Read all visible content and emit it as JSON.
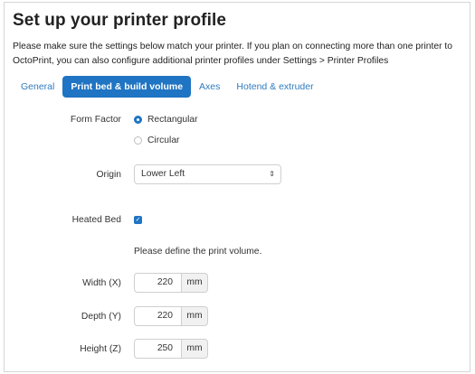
{
  "title": "Set up your printer profile",
  "description": "Please make sure the settings below match your printer. If you plan on connecting more than one printer to OctoPrint, you can also configure additional printer profiles under Settings > Printer Profiles",
  "tabs": [
    {
      "label": "General"
    },
    {
      "label": "Print bed & build volume"
    },
    {
      "label": "Axes"
    },
    {
      "label": "Hotend & extruder"
    }
  ],
  "form_factor": {
    "label": "Form Factor",
    "options": [
      {
        "label": "Rectangular",
        "checked": true
      },
      {
        "label": "Circular",
        "checked": false
      }
    ]
  },
  "origin": {
    "label": "Origin",
    "value": "Lower Left"
  },
  "heated_bed": {
    "label": "Heated Bed",
    "checked": true
  },
  "volume_hint": "Please define the print volume.",
  "width": {
    "label": "Width (X)",
    "value": "220",
    "unit": "mm"
  },
  "depth": {
    "label": "Depth (Y)",
    "value": "220",
    "unit": "mm"
  },
  "height": {
    "label": "Height (Z)",
    "value": "250",
    "unit": "mm"
  },
  "colors": {
    "accent": "#1f74c3",
    "link": "#2f7bbf"
  }
}
